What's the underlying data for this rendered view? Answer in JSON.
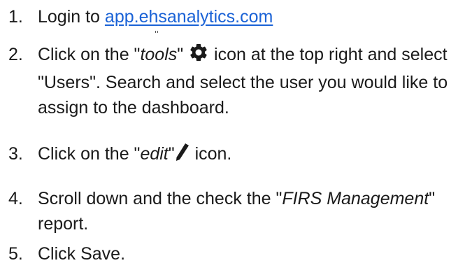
{
  "steps": [
    {
      "number": "1.",
      "text_before": "Login to ",
      "link_text": "app.ehsanalytics.com"
    },
    {
      "number": "2.",
      "text_before": "Click on the \"",
      "italic": "tools",
      "text_mid": "\" ",
      "icon": "gear-icon",
      "text_after": " icon at the top right and select \"Users\". Search and select the user you would like to assign to the dashboard."
    },
    {
      "number": "3.",
      "text_before": "Click on the \"",
      "italic": "edit",
      "text_mid": "\"",
      "icon": "pencil-icon",
      "text_after": " icon."
    },
    {
      "number": "4.",
      "text_before": "Scroll down and the check the \"",
      "italic": "FIRS Management",
      "text_after": "\" report."
    },
    {
      "number": "5.",
      "text": "Click Save."
    }
  ],
  "colors": {
    "text": "#1a1a1a",
    "link": "#1a62d6"
  }
}
